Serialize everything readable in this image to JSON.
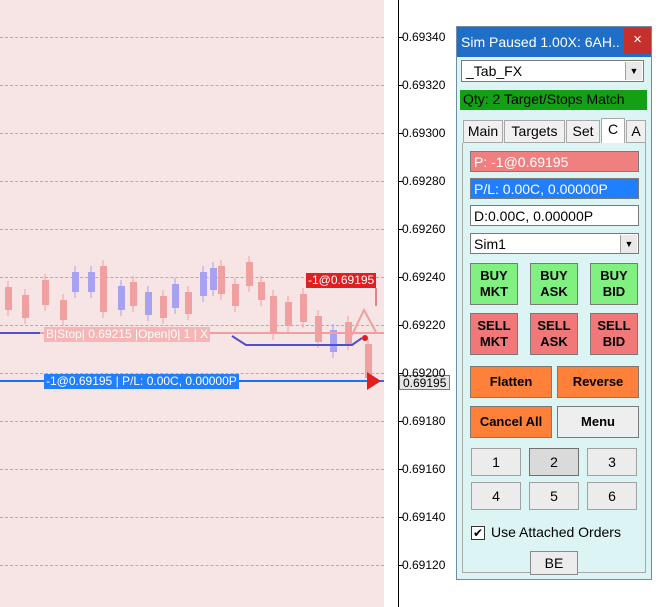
{
  "price_axis": {
    "labels": [
      "0.69340",
      "0.69320",
      "0.69300",
      "0.69280",
      "0.69260",
      "0.69240",
      "0.69220",
      "0.69200",
      "0.69180",
      "0.69160",
      "0.69140",
      "0.69120"
    ],
    "current_price": "0.69195"
  },
  "chart": {
    "position_tag": "-1@0.69195 | P/L: 0.00C, 0.00000P",
    "stop_order_tag": "B|Stop| 0.69215 |Open|0| 1 | X",
    "fill_tag": "-1@0.69195",
    "colors": {
      "up_bar": "#f0a0a0",
      "down_bar": "#a8a0f0",
      "position_line": "#1f6fff",
      "stop_line": "#f0a0a0"
    }
  },
  "panel": {
    "title": "Sim Paused 1.00X: 6AH...",
    "close_glyph": "×",
    "template_select": "_Tab_FX",
    "qty_banner": "Qty: 2 Target/Stops Match",
    "tabs": [
      {
        "label": "Main",
        "active": false
      },
      {
        "label": "Targets",
        "active": false
      },
      {
        "label": "Set",
        "active": false
      },
      {
        "label": "C",
        "active": true
      },
      {
        "label": "A",
        "active": false
      }
    ],
    "position_info": "P: -1@0.69195",
    "pl_info": "P/L: 0.00C, 0.00000P",
    "daily_info": "D:0.00C, 0.00000P",
    "account_select": "Sim1",
    "buttons": {
      "buy_mkt": [
        "BUY",
        "MKT"
      ],
      "buy_ask": [
        "BUY",
        "ASK"
      ],
      "buy_bid": [
        "BUY",
        "BID"
      ],
      "sell_mkt": [
        "SELL",
        "MKT"
      ],
      "sell_ask": [
        "SELL",
        "ASK"
      ],
      "sell_bid": [
        "SELL",
        "BID"
      ],
      "flatten": "Flatten",
      "reverse": "Reverse",
      "cancel_all": "Cancel All",
      "menu": "Menu",
      "be": "BE"
    },
    "qty_buttons": [
      "1",
      "2",
      "3",
      "4",
      "5",
      "6"
    ],
    "selected_qty": "2",
    "attached_orders_label": "Use Attached Orders",
    "attached_orders_checked": true,
    "colors": {
      "title_bar": "#1f6fc8",
      "qty_banner": "#14a014",
      "position_box": "#f08080",
      "pl_box": "#1f7fff",
      "buy": "#80f080",
      "sell": "#f07878",
      "orange": "#ff8038"
    }
  }
}
